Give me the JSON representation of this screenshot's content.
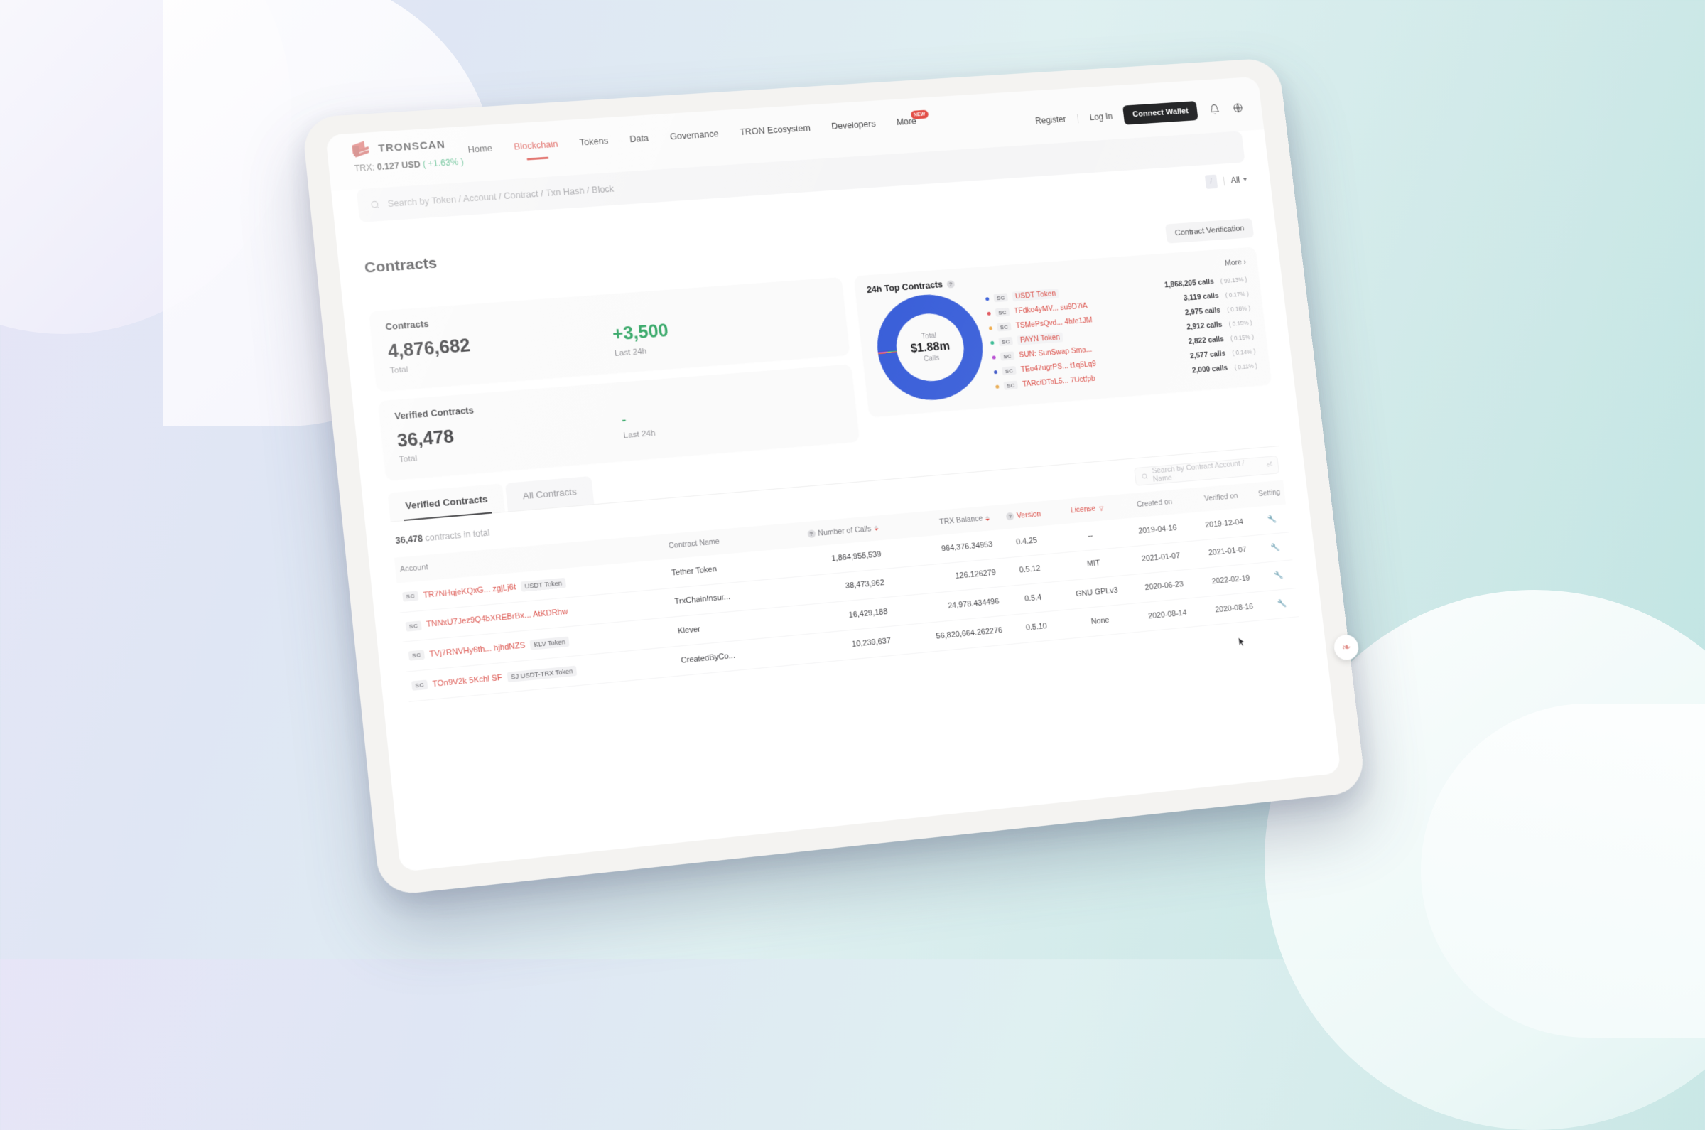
{
  "brand": {
    "name": "TRONSCAN",
    "price_label": "TRX:",
    "price": "0.127 USD",
    "change": "( +1.63% )"
  },
  "nav": {
    "items": [
      {
        "label": "Home",
        "active": false
      },
      {
        "label": "Blockchain",
        "active": true
      },
      {
        "label": "Tokens",
        "active": false
      },
      {
        "label": "Data",
        "active": false
      },
      {
        "label": "Governance",
        "active": false
      },
      {
        "label": "TRON Ecosystem",
        "active": false
      },
      {
        "label": "Developers",
        "active": false
      },
      {
        "label": "More",
        "active": false,
        "badge": "NEW"
      }
    ],
    "register": "Register",
    "login": "Log In",
    "connect_wallet": "Connect Wallet",
    "bell_icon": "bell-icon",
    "language_icon": "globe-icon"
  },
  "search": {
    "placeholder": "Search by Token / Account / Contract / Txn Hash / Block",
    "icon": "search-icon"
  },
  "filter_row": {
    "selector": "All",
    "chip": "/"
  },
  "header": {
    "title": "Contracts",
    "verify_button": "Contract Verification"
  },
  "cards": {
    "contracts": {
      "title": "Contracts",
      "total_value": "4,876,682",
      "total_label": "Total",
      "delta_value": "+3,500",
      "delta_label": "Last 24h"
    },
    "verified": {
      "title": "Verified Contracts",
      "total_value": "36,478",
      "total_label": "Total",
      "delta_value": "-",
      "delta_label": "Last 24h"
    }
  },
  "top_contracts": {
    "title": "24h Top Contracts",
    "more": "More ›",
    "center_top": "Total",
    "center_value": "$1.88m",
    "center_bottom": "Calls"
  },
  "chart_data": {
    "type": "pie",
    "title": "24h Top Contracts",
    "center_label": "Total $1.88m Calls",
    "total_calls": 1880000,
    "legend_position": "right",
    "categories": [
      "USDT Token",
      "TFdko4yMV... su9D7iA",
      "TSMePsQvd... 4hfe1JM",
      "PAYN Token",
      "SUN: SunSwap Sma...",
      "TEo47ugrPS... t1q5Lq9",
      "TARciDTaL5... 7Uctfpb"
    ],
    "values": [
      1868205,
      3119,
      2975,
      2912,
      2822,
      2577,
      2000
    ],
    "percents": [
      "99.13%",
      "0.17%",
      "0.16%",
      "0.15%",
      "0.15%",
      "0.14%",
      "0.11%"
    ],
    "value_labels": [
      "1,868,205 calls",
      "3,119 calls",
      "2,975 calls",
      "2,912 calls",
      "2,822 calls",
      "2,577 calls",
      "2,000 calls"
    ],
    "colors": [
      "#3a5fd9",
      "#e0555c",
      "#f0ab4a",
      "#31b88f",
      "#b64bd0",
      "#3b55c6",
      "#e8a94e"
    ],
    "badge": "SC"
  },
  "table": {
    "tabs": [
      {
        "label": "Verified Contracts",
        "active": true
      },
      {
        "label": "All Contracts",
        "active": false
      }
    ],
    "count_value": "36,478",
    "count_suffix": "contracts in total",
    "search_placeholder": "Search by Contract Account / Name",
    "columns": [
      "Account",
      "Contract Name",
      "Number of Calls",
      "TRX Balance",
      "Version",
      "License",
      "Created on",
      "Verified on",
      "Setting"
    ],
    "rows": [
      {
        "badge": "SC",
        "address": "TR7NHqjeKQxG... zgjLj6t",
        "token": "USDT Token",
        "name": "Tether Token",
        "calls": "1,864,955,539",
        "balance": "964,376.34953",
        "version": "0.4.25",
        "license": "--",
        "created": "2019-04-16",
        "verified": "2019-12-04",
        "setting": "wrench-icon"
      },
      {
        "badge": "SC",
        "address": "TNNxU7Jez9Q4bXREBrBx... AtKDRhw",
        "token": "",
        "name": "TrxChainInsur...",
        "calls": "38,473,962",
        "balance": "126.126279",
        "version": "0.5.12",
        "license": "MIT",
        "created": "2021-01-07",
        "verified": "2021-01-07",
        "setting": "wrench-icon"
      },
      {
        "badge": "SC",
        "address": "TVj7RNVHy6th... hjhdNZS",
        "token": "KLV Token",
        "name": "Klever",
        "calls": "16,429,188",
        "balance": "24,978.434496",
        "version": "0.5.4",
        "license": "GNU GPLv3",
        "created": "2020-06-23",
        "verified": "2022-02-19",
        "setting": "wrench-icon"
      },
      {
        "badge": "SC",
        "address": "TOn9V2k 5Kchl SF",
        "token": "SJ USDT-TRX Token",
        "name": "CreatedByCo...",
        "calls": "10,239,637",
        "balance": "56,820,664.262276",
        "version": "0.5.10",
        "license": "None",
        "created": "2020-08-14",
        "verified": "2020-08-16",
        "setting": "wrench-icon"
      }
    ]
  },
  "float_widget": {
    "icon": "tron-widget-icon"
  }
}
